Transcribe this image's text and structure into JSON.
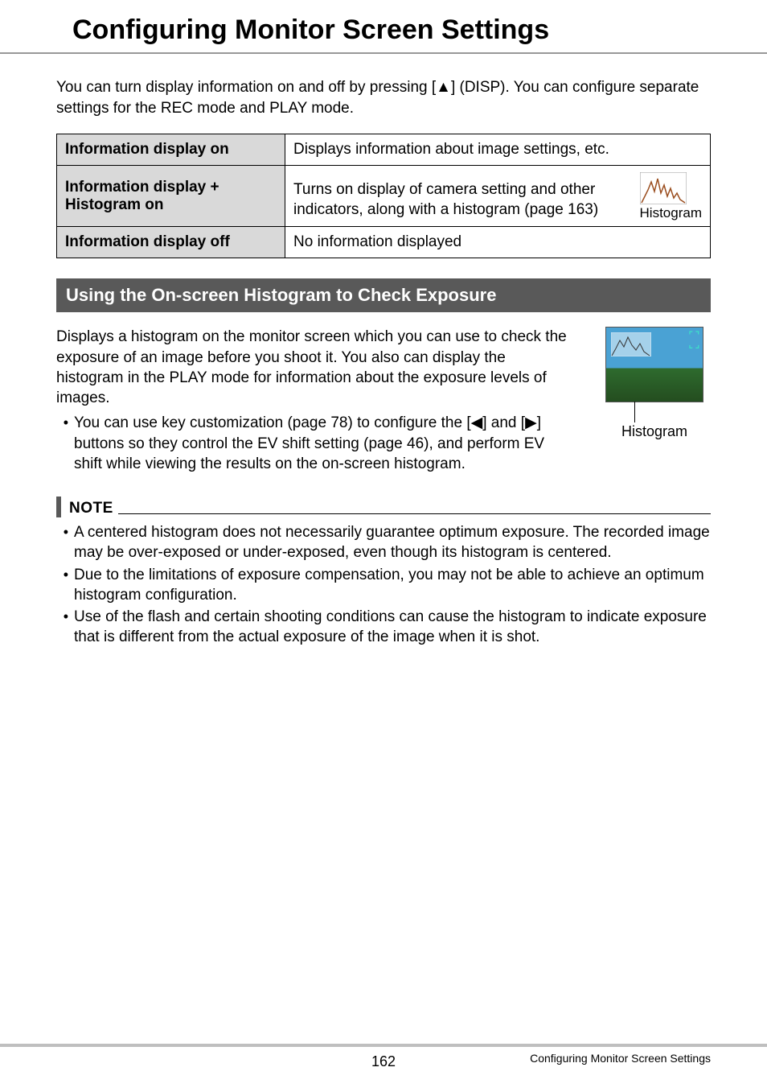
{
  "title": "Configuring Monitor Screen Settings",
  "intro_pre": "You can turn display information on and off by pressing [",
  "intro_post": "] (DISP). You can configure separate settings for the REC mode and PLAY mode.",
  "intro_arrow": "▲",
  "table": {
    "row1": {
      "label": "Information display on",
      "value": "Displays information about image settings, etc."
    },
    "row2": {
      "label": "Information display + Histogram on",
      "value": "Turns on display of camera setting and other indicators, along with a histogram (page 163)",
      "icon_caption": "Histogram"
    },
    "row3": {
      "label": "Information display off",
      "value": "No information displayed"
    }
  },
  "section_title": "Using the On-screen Histogram to Check Exposure",
  "section_para": "Displays a histogram on the monitor screen which you can use to check the exposure of an image before you shoot it. You also can display the histogram in the PLAY mode for information about the exposure levels of images.",
  "section_bullet_pre": "You can use key customization (page 78) to configure the [",
  "section_bullet_mid1": "] and [",
  "section_bullet_mid2": "] buttons so they control the EV shift setting (page 46), and perform EV shift while viewing the results on the on-screen histogram.",
  "left_arrow": "◀",
  "right_arrow": "▶",
  "thumb_caption": "Histogram",
  "note_label": "NOTE",
  "notes": [
    "A centered histogram does not necessarily guarantee optimum exposure. The recorded image may be over-exposed or under-exposed, even though its histogram is centered.",
    "Due to the limitations of exposure compensation, you may not be able to achieve an optimum histogram configuration.",
    "Use of the flash and certain shooting conditions can cause the histogram to indicate exposure that is different from the actual exposure of the image when it is shot."
  ],
  "footer": {
    "page_number": "162",
    "section": "Configuring Monitor Screen Settings"
  }
}
